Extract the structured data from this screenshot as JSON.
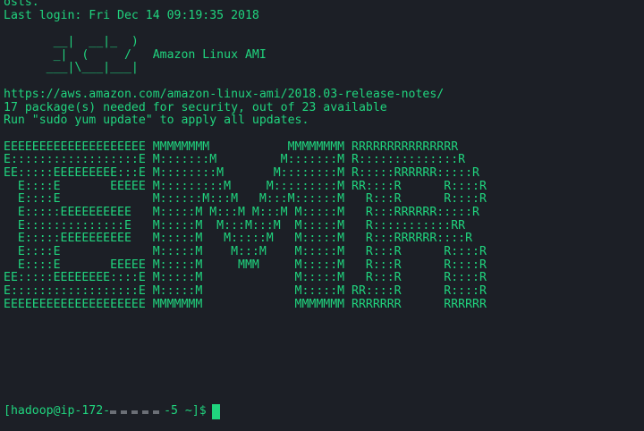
{
  "terminal": {
    "lines": [
      "osts.",
      "Last login: Fri Dec 14 09:19:35 2018",
      "",
      "       __|  __|_  )",
      "       _|  (     /   Amazon Linux AMI",
      "      ___|\\___|___|",
      "",
      "https://aws.amazon.com/amazon-linux-ami/2018.03-release-notes/",
      "17 package(s) needed for security, out of 23 available",
      "Run \"sudo yum update\" to apply all updates.",
      "",
      "EEEEEEEEEEEEEEEEEEEE MMMMMMMM           MMMMMMMM RRRRRRRRRRRRRRR",
      "E::::::::::::::::::E M:::::::M         M:::::::M R::::::::::::::R",
      "EE:::::EEEEEEEEE:::E M::::::::M       M::::::::M R:::::RRRRRR:::::R",
      "  E::::E       EEEEE M:::::::::M     M:::::::::M RR::::R      R::::R",
      "  E::::E             M::::::M:::M   M:::M::::::M   R:::R      R::::R",
      "  E:::::EEEEEEEEEE   M:::::M M:::M M:::M M:::::M   R:::RRRRRR:::::R",
      "  E::::::::::::::E   M:::::M  M:::M:::M  M:::::M   R:::::::::::RR",
      "  E:::::EEEEEEEEEE   M:::::M   M:::::M   M:::::M   R:::RRRRRR::::R",
      "  E::::E             M:::::M    M:::M    M:::::M   R:::R      R::::R",
      "  E::::E       EEEEE M:::::M     MMM     M:::::M   R:::R      R::::R",
      "EE:::::EEEEEEEE::::E M:::::M             M:::::M   R:::R      R::::R",
      "E::::::::::::::::::E M:::::M             M:::::M RR::::R      R::::R",
      "EEEEEEEEEEEEEEEEEEEE MMMMMMM             MMMMMMM RRRRRRR      RRRRRR"
    ],
    "prompt_prefix": "[hadoop@ip-172-",
    "prompt_suffix": "-5 ~]$",
    "colors": {
      "background": "#1c1f26",
      "text": "#20d47e"
    }
  }
}
